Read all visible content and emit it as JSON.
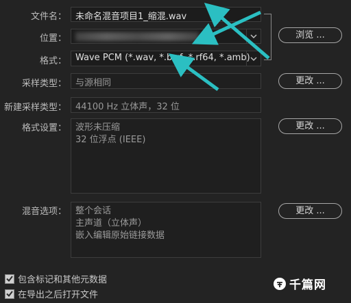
{
  "form": {
    "filename_label": "文件名：",
    "filename_value": "未命名混音项目1_缩混.wav",
    "location_label": "位置：",
    "browse_label": "浏览 ...",
    "format_label": "格式：",
    "format_value": "Wave PCM (*.wav, *.bwf, *.rf64, *.amb)",
    "sample_type_label": "采样类型：",
    "sample_type_value": "与源相同",
    "change_label": "更改 ...",
    "new_sample_type_label": "新建采样类型：",
    "new_sample_type_value": "44100 Hz 立体声，32 位",
    "format_settings_label": "格式设置：",
    "format_settings_lines": [
      "波形未压缩",
      "32 位浮点 (IEEE)"
    ],
    "mix_options_label": "混音选项：",
    "mix_options_lines": [
      "整个会话",
      "主声道（立体声）",
      "嵌入编辑原始链接数据"
    ],
    "include_markers_label": "包含标记和其他元数据",
    "include_markers_checked": true,
    "open_after_export_label": "在导出之后打开文件",
    "open_after_export_checked": true
  },
  "watermark": {
    "text": "千篇网"
  },
  "colors": {
    "arrow": "#2bbfc2",
    "background": "#232323"
  }
}
